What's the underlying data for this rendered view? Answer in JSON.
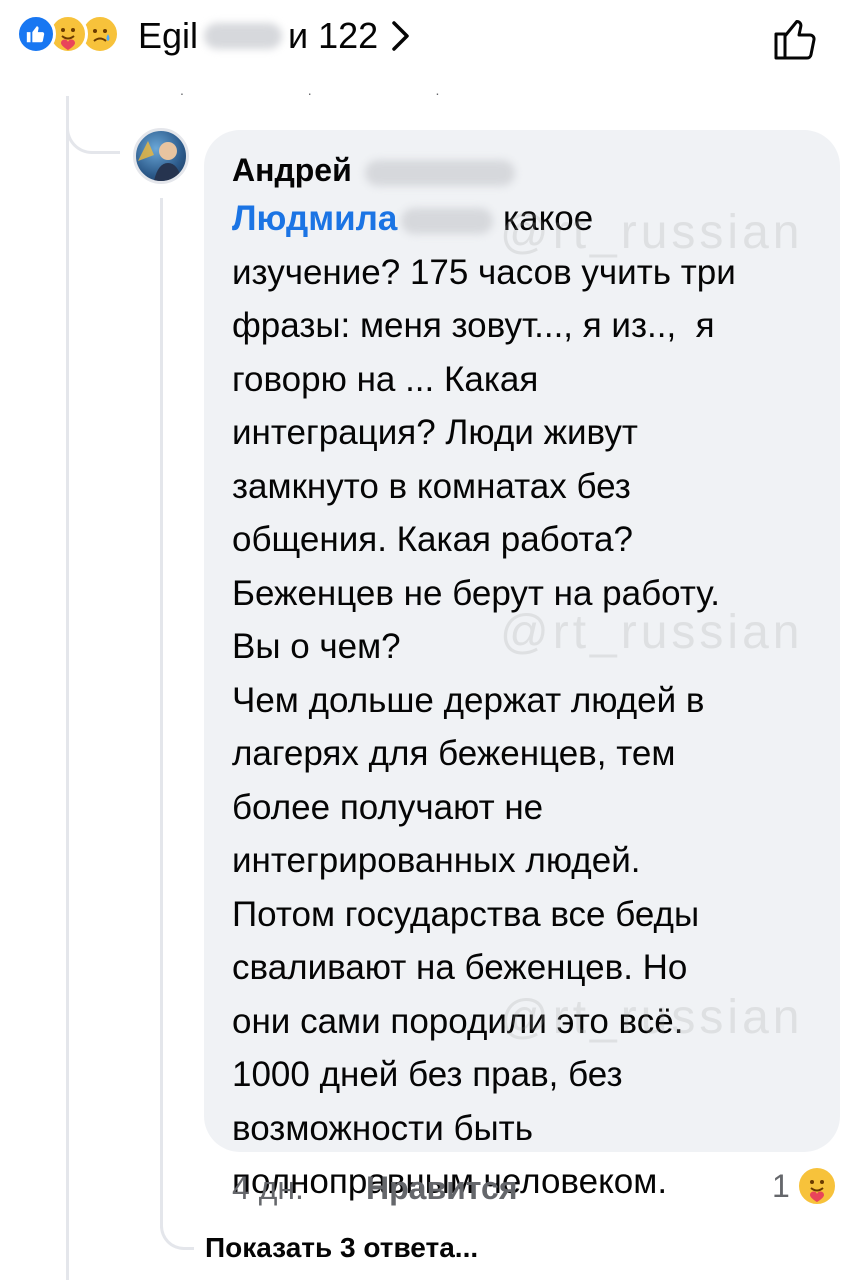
{
  "reactions_bar": {
    "names_prefix": "Egil",
    "names_suffix": "и 122",
    "icons": [
      "like-icon",
      "care-icon",
      "sad-icon"
    ]
  },
  "comment": {
    "author_first": "Андрей",
    "mention": "Людмила",
    "text_after_mention": " какое\nизучение? 175 часов учить три\nфразы: меня зовут..., я из..,  я\nговорю на ... Какая\nинтеграция? Люди живут\nзамкнуто в комнатах без\nобщения. Какая работа?\nБеженцев не берут на работу.\nВы о чем?\nЧем дольше держат людей в\nлагерях для беженцев, тем\nболее получают не\nинтегрированных людей.\nПотом государства все беды\nсваливают на беженцев. Но\nони сами породили это всё.\n1000 дней без прав, без\nвозможности быть\nполноправным человеком.",
    "time": "4 дн.",
    "like_label": "Нравится",
    "reaction_count": "1"
  },
  "replies": {
    "show_label": "Показать 3 ответа..."
  },
  "watermark": {
    "text": "@rt_russian"
  },
  "colors": {
    "mention": "#1b74e4",
    "bubble": "#f0f2f5",
    "secondary_text": "#65676b",
    "like_blue": "#1877f2"
  }
}
